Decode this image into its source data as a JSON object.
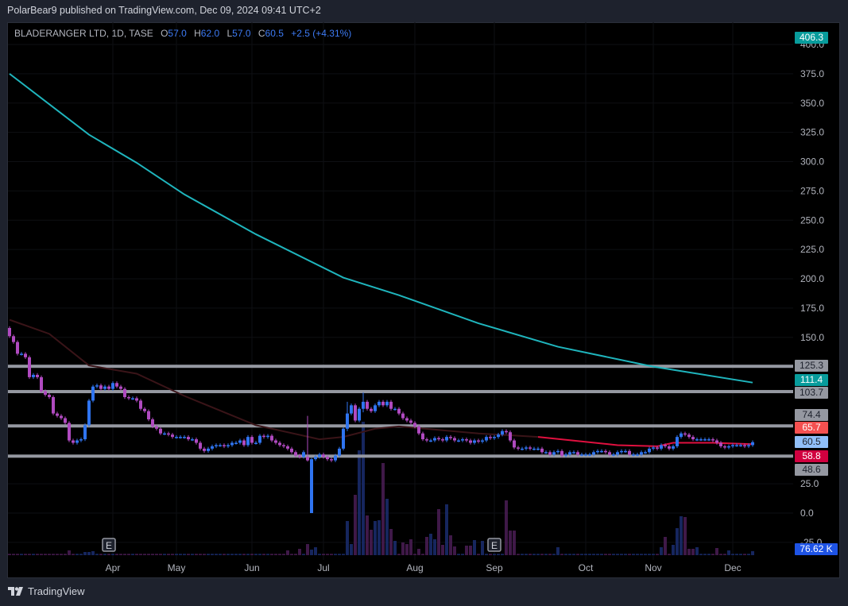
{
  "published": "PolarBear9 published on TradingView.com, Dec 09, 2024 09:41 UTC+2",
  "legend": {
    "symbol": "BLADERANGER LTD, 1D, TASE",
    "o_label": "O",
    "o": "57.0",
    "h_label": "H",
    "h": "62.0",
    "l_label": "L",
    "l": "57.0",
    "c_label": "C",
    "c": "60.5",
    "change": "+2.5 (+4.31%)"
  },
  "footer": {
    "brand": "TradingView"
  },
  "colors": {
    "up": "#2f74f0",
    "down": "#b04ac0",
    "ma200": "#1fb5bd",
    "ma50": "#e0103f",
    "hline": "#9598a1"
  },
  "price_labels": [
    {
      "text": "406.3",
      "value": 406.3,
      "bg": "#089c9c",
      "fg": "#ffffff"
    },
    {
      "text": "125.3",
      "value": 125.3,
      "bg": "#9598a1",
      "fg": "#1e222d"
    },
    {
      "text": "111.4",
      "value": 111.4,
      "bg": "#089c9c",
      "fg": "#ffffff"
    },
    {
      "text": "103.7",
      "value": 103.7,
      "bg": "#9598a1",
      "fg": "#1e222d"
    },
    {
      "text": "74.4",
      "value": 74.4,
      "bg": "#9598a1",
      "fg": "#1e222d"
    },
    {
      "text": "65.7",
      "value": 65.7,
      "bg": "#f55050",
      "fg": "#ffffff"
    },
    {
      "text": "60.5",
      "value": 60.5,
      "bg": "#90bff9",
      "fg": "#1e222d"
    },
    {
      "text": "58.8",
      "value": 58.8,
      "bg": "#d1003f",
      "fg": "#ffffff"
    },
    {
      "text": "48.6",
      "value": 48.6,
      "bg": "#9598a1",
      "fg": "#1e222d"
    }
  ],
  "volume_label": {
    "text": "76.62 K",
    "bg": "#1e53e5",
    "fg": "#ffffff"
  },
  "chart_data": {
    "type": "candlestick",
    "title": "BLADERANGER LTD, 1D, TASE",
    "y_ticks": [
      "400.0",
      "375.0",
      "350.0",
      "325.0",
      "300.0",
      "275.0",
      "250.0",
      "225.0",
      "200.0",
      "175.0",
      "150.0",
      "25.0",
      "0.0",
      "-25.0"
    ],
    "y_tick_values": [
      400,
      375,
      350,
      325,
      300,
      275,
      250,
      225,
      200,
      175,
      150,
      25,
      0,
      -25
    ],
    "ylim": [
      -30,
      415
    ],
    "x_labels": [
      {
        "text": "Apr",
        "bar": 26
      },
      {
        "text": "May",
        "bar": 42
      },
      {
        "text": "Jun",
        "bar": 61
      },
      {
        "text": "Jul",
        "bar": 79
      },
      {
        "text": "Aug",
        "bar": 102
      },
      {
        "text": "Sep",
        "bar": 122
      },
      {
        "text": "Oct",
        "bar": 145
      },
      {
        "text": "Nov",
        "bar": 162
      },
      {
        "text": "Dec",
        "bar": 182
      }
    ],
    "earnings_markers": [
      {
        "text": "E",
        "bar": 25
      },
      {
        "text": "E",
        "bar": 122
      }
    ],
    "horizontal_levels": [
      125.3,
      103.7,
      74.4,
      48.6
    ],
    "open_first": 158,
    "closes": [
      151,
      146,
      136,
      136,
      133,
      116,
      118,
      116,
      104,
      101,
      99,
      85,
      83,
      81,
      77,
      62,
      60,
      62,
      63,
      75,
      96,
      108,
      109,
      106,
      108,
      106,
      111,
      108,
      106,
      99,
      98,
      98,
      96,
      89,
      87,
      80,
      74,
      72,
      68,
      68,
      67,
      65,
      65,
      65,
      65,
      63,
      63,
      60,
      55,
      53,
      55,
      57,
      58,
      58,
      57,
      58,
      60,
      60,
      62,
      58,
      65,
      60,
      60,
      66,
      65,
      66,
      62,
      60,
      58,
      57,
      55,
      52,
      49,
      48,
      52,
      49,
      46,
      48,
      50,
      48,
      46,
      45,
      49,
      55,
      72,
      85,
      92,
      79,
      89,
      95,
      89,
      87,
      92,
      95,
      92,
      95,
      89,
      89,
      85,
      81,
      79,
      77,
      74,
      68,
      63,
      62,
      62,
      64,
      63,
      62,
      65,
      64,
      62,
      62,
      63,
      62,
      60,
      62,
      61,
      62,
      65,
      64,
      65,
      67,
      70,
      69,
      62,
      56,
      55,
      55,
      56,
      55,
      55,
      55,
      52,
      52,
      50,
      52,
      53,
      49,
      50,
      52,
      52,
      50,
      50,
      50,
      50,
      52,
      53,
      53,
      52,
      50,
      50,
      52,
      53,
      53,
      50,
      50,
      50,
      52,
      52,
      55,
      56,
      55,
      58,
      57,
      55,
      57,
      65,
      68,
      67,
      65,
      63,
      63,
      63,
      63,
      63,
      62,
      60,
      57,
      56,
      57,
      58,
      58,
      58,
      57,
      58,
      60.5
    ],
    "candle_overrides": {
      "75": {
        "open": 48,
        "close": 45,
        "high": 83,
        "low": 44
      },
      "76": {
        "open": 0,
        "close": 46,
        "high": 47,
        "low": 0
      },
      "85": {
        "open": 72,
        "close": 85,
        "high": 95,
        "low": 70
      },
      "89": {
        "open": 89,
        "close": 95,
        "high": 103,
        "low": 86
      }
    },
    "volume_default_k": 25,
    "volume_k": {
      "15": 90,
      "19": 60,
      "20": 60,
      "21": 75,
      "70": 90,
      "73": 120,
      "75": 210,
      "76": 105,
      "77": 150,
      "85": 645,
      "86": 210,
      "87": 1140,
      "88": 1980,
      "89": 2520,
      "90": 750,
      "91": 480,
      "92": 645,
      "93": 660,
      "94": 1740,
      "95": 1065,
      "96": 495,
      "97": 270,
      "99": 240,
      "100": 210,
      "101": 300,
      "103": 120,
      "105": 345,
      "106": 405,
      "107": 300,
      "108": 870,
      "109": 195,
      "110": 960,
      "111": 375,
      "112": 165,
      "115": 180,
      "116": 180,
      "117": 285,
      "119": 270,
      "125": 1035,
      "126": 465,
      "127": 465,
      "138": 150,
      "164": 150,
      "165": 345,
      "167": 195,
      "168": 510,
      "169": 735,
      "170": 720,
      "171": 120,
      "172": 120,
      "173": 150,
      "178": 135,
      "181": 90,
      "187": 76.62
    },
    "ma200": [
      [
        0,
        375
      ],
      [
        20,
        323
      ],
      [
        32,
        299
      ],
      [
        44,
        272
      ],
      [
        62,
        238
      ],
      [
        84,
        201
      ],
      [
        98,
        186
      ],
      [
        118,
        162
      ],
      [
        138,
        142
      ],
      [
        162,
        125
      ],
      [
        187,
        111.4
      ]
    ],
    "ma50": [
      [
        0,
        165
      ],
      [
        10,
        153
      ],
      [
        20,
        126
      ],
      [
        32,
        119
      ],
      [
        44,
        100
      ],
      [
        62,
        75
      ],
      [
        78,
        63
      ],
      [
        84,
        65
      ],
      [
        92,
        72
      ],
      [
        98,
        74
      ],
      [
        118,
        68
      ],
      [
        133,
        65
      ],
      [
        153,
        58
      ],
      [
        163,
        57
      ],
      [
        167,
        60
      ],
      [
        177,
        60
      ],
      [
        187,
        58.8
      ]
    ],
    "ma50_highlight_from_bar": 133
  }
}
